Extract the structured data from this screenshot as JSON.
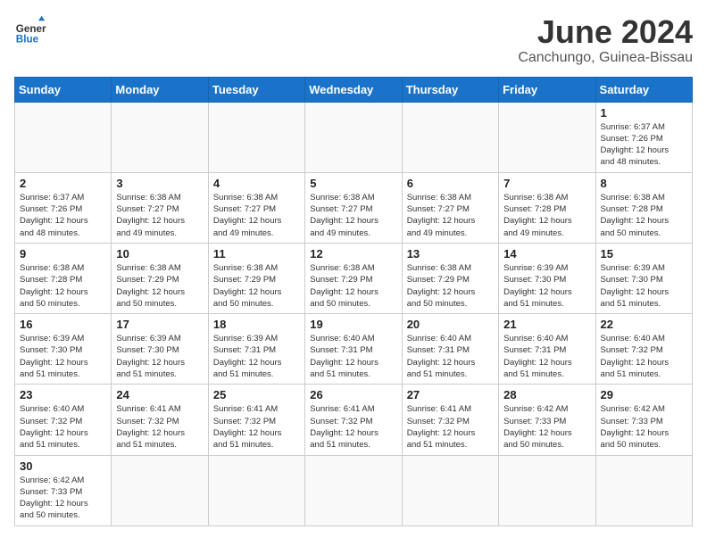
{
  "header": {
    "logo_general": "General",
    "logo_blue": "Blue",
    "month_title": "June 2024",
    "location": "Canchungo, Guinea-Bissau"
  },
  "weekdays": [
    "Sunday",
    "Monday",
    "Tuesday",
    "Wednesday",
    "Thursday",
    "Friday",
    "Saturday"
  ],
  "days": [
    {
      "date": 1,
      "sunrise": "6:37 AM",
      "sunset": "7:26 PM",
      "daylight_hours": 12,
      "daylight_minutes": 48
    },
    {
      "date": 2,
      "sunrise": "6:37 AM",
      "sunset": "7:26 PM",
      "daylight_hours": 12,
      "daylight_minutes": 48
    },
    {
      "date": 3,
      "sunrise": "6:38 AM",
      "sunset": "7:27 PM",
      "daylight_hours": 12,
      "daylight_minutes": 49
    },
    {
      "date": 4,
      "sunrise": "6:38 AM",
      "sunset": "7:27 PM",
      "daylight_hours": 12,
      "daylight_minutes": 49
    },
    {
      "date": 5,
      "sunrise": "6:38 AM",
      "sunset": "7:27 PM",
      "daylight_hours": 12,
      "daylight_minutes": 49
    },
    {
      "date": 6,
      "sunrise": "6:38 AM",
      "sunset": "7:27 PM",
      "daylight_hours": 12,
      "daylight_minutes": 49
    },
    {
      "date": 7,
      "sunrise": "6:38 AM",
      "sunset": "7:28 PM",
      "daylight_hours": 12,
      "daylight_minutes": 49
    },
    {
      "date": 8,
      "sunrise": "6:38 AM",
      "sunset": "7:28 PM",
      "daylight_hours": 12,
      "daylight_minutes": 50
    },
    {
      "date": 9,
      "sunrise": "6:38 AM",
      "sunset": "7:28 PM",
      "daylight_hours": 12,
      "daylight_minutes": 50
    },
    {
      "date": 10,
      "sunrise": "6:38 AM",
      "sunset": "7:29 PM",
      "daylight_hours": 12,
      "daylight_minutes": 50
    },
    {
      "date": 11,
      "sunrise": "6:38 AM",
      "sunset": "7:29 PM",
      "daylight_hours": 12,
      "daylight_minutes": 50
    },
    {
      "date": 12,
      "sunrise": "6:38 AM",
      "sunset": "7:29 PM",
      "daylight_hours": 12,
      "daylight_minutes": 50
    },
    {
      "date": 13,
      "sunrise": "6:38 AM",
      "sunset": "7:29 PM",
      "daylight_hours": 12,
      "daylight_minutes": 50
    },
    {
      "date": 14,
      "sunrise": "6:39 AM",
      "sunset": "7:30 PM",
      "daylight_hours": 12,
      "daylight_minutes": 51
    },
    {
      "date": 15,
      "sunrise": "6:39 AM",
      "sunset": "7:30 PM",
      "daylight_hours": 12,
      "daylight_minutes": 51
    },
    {
      "date": 16,
      "sunrise": "6:39 AM",
      "sunset": "7:30 PM",
      "daylight_hours": 12,
      "daylight_minutes": 51
    },
    {
      "date": 17,
      "sunrise": "6:39 AM",
      "sunset": "7:30 PM",
      "daylight_hours": 12,
      "daylight_minutes": 51
    },
    {
      "date": 18,
      "sunrise": "6:39 AM",
      "sunset": "7:31 PM",
      "daylight_hours": 12,
      "daylight_minutes": 51
    },
    {
      "date": 19,
      "sunrise": "6:40 AM",
      "sunset": "7:31 PM",
      "daylight_hours": 12,
      "daylight_minutes": 51
    },
    {
      "date": 20,
      "sunrise": "6:40 AM",
      "sunset": "7:31 PM",
      "daylight_hours": 12,
      "daylight_minutes": 51
    },
    {
      "date": 21,
      "sunrise": "6:40 AM",
      "sunset": "7:31 PM",
      "daylight_hours": 12,
      "daylight_minutes": 51
    },
    {
      "date": 22,
      "sunrise": "6:40 AM",
      "sunset": "7:32 PM",
      "daylight_hours": 12,
      "daylight_minutes": 51
    },
    {
      "date": 23,
      "sunrise": "6:40 AM",
      "sunset": "7:32 PM",
      "daylight_hours": 12,
      "daylight_minutes": 51
    },
    {
      "date": 24,
      "sunrise": "6:41 AM",
      "sunset": "7:32 PM",
      "daylight_hours": 12,
      "daylight_minutes": 51
    },
    {
      "date": 25,
      "sunrise": "6:41 AM",
      "sunset": "7:32 PM",
      "daylight_hours": 12,
      "daylight_minutes": 51
    },
    {
      "date": 26,
      "sunrise": "6:41 AM",
      "sunset": "7:32 PM",
      "daylight_hours": 12,
      "daylight_minutes": 51
    },
    {
      "date": 27,
      "sunrise": "6:41 AM",
      "sunset": "7:32 PM",
      "daylight_hours": 12,
      "daylight_minutes": 51
    },
    {
      "date": 28,
      "sunrise": "6:42 AM",
      "sunset": "7:33 PM",
      "daylight_hours": 12,
      "daylight_minutes": 50
    },
    {
      "date": 29,
      "sunrise": "6:42 AM",
      "sunset": "7:33 PM",
      "daylight_hours": 12,
      "daylight_minutes": 50
    },
    {
      "date": 30,
      "sunrise": "6:42 AM",
      "sunset": "7:33 PM",
      "daylight_hours": 12,
      "daylight_minutes": 50
    }
  ]
}
